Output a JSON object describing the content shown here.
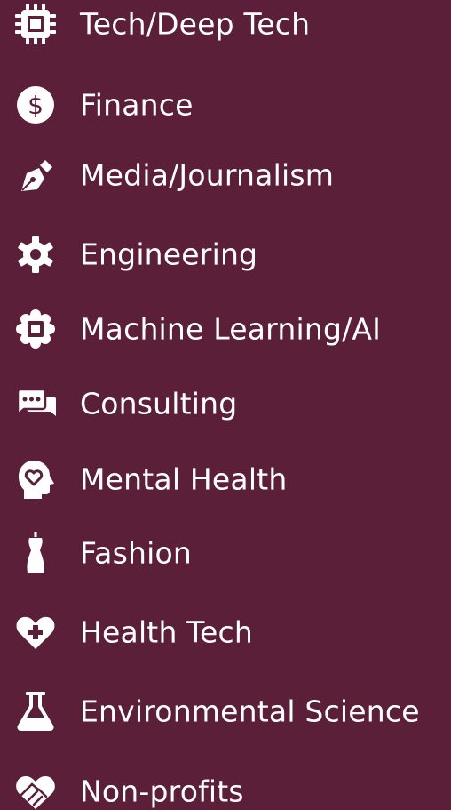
{
  "colors": {
    "background": "#5c1f39",
    "foreground": "#ffffff"
  },
  "items": [
    {
      "label": "Tech/Deep Tech",
      "icon": "microchip-icon"
    },
    {
      "label": "Finance",
      "icon": "dollar-circle-icon"
    },
    {
      "label": "Media/Journalism",
      "icon": "pen-nib-icon"
    },
    {
      "label": "Engineering",
      "icon": "gear-icon"
    },
    {
      "label": "Machine Learning/AI",
      "icon": "ai-chip-gear-icon"
    },
    {
      "label": "Consulting",
      "icon": "chat-bubbles-icon"
    },
    {
      "label": "Mental Health",
      "icon": "head-heart-icon"
    },
    {
      "label": "Fashion",
      "icon": "dress-form-icon"
    },
    {
      "label": "Health Tech",
      "icon": "heart-plus-icon"
    },
    {
      "label": "Environmental Science",
      "icon": "flask-icon"
    },
    {
      "label": "Non-profits",
      "icon": "handshake-heart-icon"
    }
  ]
}
